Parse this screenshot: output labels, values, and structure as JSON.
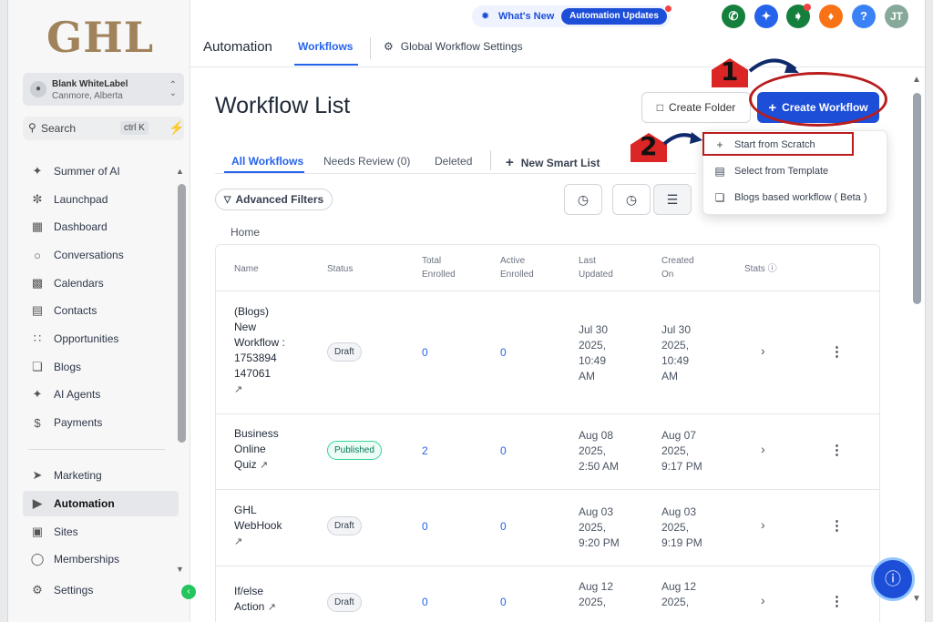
{
  "brand": {
    "logo_text": "GHL"
  },
  "account": {
    "name": "Blank WhiteLabel",
    "location": "Canmore, Alberta"
  },
  "search": {
    "label": "Search",
    "shortcut": "ctrl K"
  },
  "sidebar": {
    "items": [
      {
        "label": "Summer of AI",
        "icon": "sparkle-icon"
      },
      {
        "label": "Launchpad",
        "icon": "rocket-icon"
      },
      {
        "label": "Dashboard",
        "icon": "grid-icon"
      },
      {
        "label": "Conversations",
        "icon": "chat-icon"
      },
      {
        "label": "Calendars",
        "icon": "calendar-icon"
      },
      {
        "label": "Contacts",
        "icon": "contacts-icon"
      },
      {
        "label": "Opportunities",
        "icon": "pipeline-icon"
      },
      {
        "label": "Blogs",
        "icon": "cube-icon"
      },
      {
        "label": "AI Agents",
        "icon": "sparkle-icon"
      },
      {
        "label": "Payments",
        "icon": "dollar-icon"
      }
    ],
    "bottom_items": [
      {
        "label": "Marketing",
        "icon": "send-icon"
      },
      {
        "label": "Automation",
        "icon": "play-icon",
        "active": true
      },
      {
        "label": "Sites",
        "icon": "globe-icon"
      },
      {
        "label": "Memberships",
        "icon": "badge-icon"
      },
      {
        "label": "Settings",
        "icon": "gear-icon"
      }
    ]
  },
  "topbar": {
    "whats_new": "What's New",
    "automation_updates": "Automation Updates",
    "section_title": "Automation",
    "tab_workflows": "Workflows",
    "global_settings": "Global Workflow Settings",
    "avatar_initials": "JT",
    "help_glyph": "?"
  },
  "main": {
    "title": "Workflow List",
    "create_folder": "Create Folder",
    "create_workflow": "Create Workflow",
    "tabs": [
      "All Workflows",
      "Needs Review (0)",
      "Deleted"
    ],
    "new_smart_list": "New Smart List",
    "advanced_filters": "Advanced Filters",
    "breadcrumb_home": "Home"
  },
  "table": {
    "headers": {
      "name": "Name",
      "status": "Status",
      "total_enrolled": [
        "Total",
        "Enrolled"
      ],
      "active_enrolled": [
        "Active",
        "Enrolled"
      ],
      "last_updated": [
        "Last",
        "Updated"
      ],
      "created_on": [
        "Created",
        "On"
      ],
      "stats": "Stats"
    },
    "rows": [
      {
        "name": [
          "(Blogs)",
          "New",
          "Workflow :",
          "1753894",
          "147061"
        ],
        "status": "Draft",
        "total": "0",
        "active": "0",
        "updated": [
          "Jul 30",
          "2025,",
          "10:49",
          "AM"
        ],
        "created": [
          "Jul 30",
          "2025,",
          "10:49",
          "AM"
        ]
      },
      {
        "name": [
          "Business",
          "Online",
          "Quiz"
        ],
        "status": "Published",
        "total": "2",
        "active": "0",
        "updated": [
          "Aug 08",
          "2025,",
          "2:50 AM"
        ],
        "created": [
          "Aug 07",
          "2025,",
          "9:17 PM"
        ]
      },
      {
        "name": [
          "GHL",
          "WebHook"
        ],
        "status": "Draft",
        "total": "0",
        "active": "0",
        "updated": [
          "Aug 03",
          "2025,",
          "9:20 PM"
        ],
        "created": [
          "Aug 03",
          "2025,",
          "9:19 PM"
        ]
      },
      {
        "name": [
          "If/else",
          "Action"
        ],
        "status": "Draft",
        "total": "0",
        "active": "0",
        "updated": [
          "Aug 12",
          "2025,"
        ],
        "created": [
          "Aug 12",
          "2025,"
        ]
      }
    ]
  },
  "dropdown": {
    "items": [
      {
        "label": "Start from Scratch",
        "icon": "plus-icon"
      },
      {
        "label": "Select from Template",
        "icon": "template-icon"
      },
      {
        "label": "Blogs based workflow ( Beta )",
        "icon": "cube-icon"
      }
    ]
  },
  "annotations": {
    "step1": "1",
    "step2": "2"
  },
  "colors": {
    "primary": "#1d4ed8",
    "annotation_red": "#b91c1c",
    "success": "#22c55e"
  }
}
